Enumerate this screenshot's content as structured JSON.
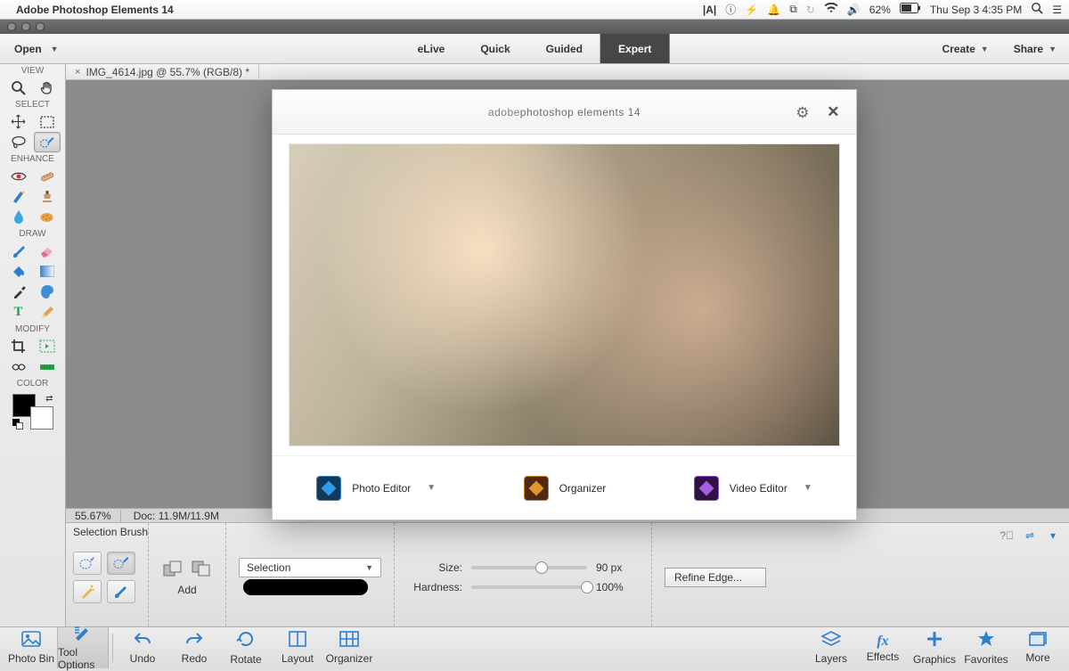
{
  "mac_menubar": {
    "app_name": "Adobe Photoshop Elements 14",
    "battery": "62%",
    "clock": "Thu Sep 3  4:35 PM"
  },
  "top_toolbar": {
    "open_label": "Open",
    "modes": {
      "elive": "eLive",
      "quick": "Quick",
      "guided": "Guided",
      "expert": "Expert"
    },
    "create_label": "Create",
    "share_label": "Share"
  },
  "sidebar": {
    "labels": {
      "view": "VIEW",
      "select": "SELECT",
      "enhance": "ENHANCE",
      "draw": "DRAW",
      "modify": "MODIFY",
      "color": "COLOR"
    }
  },
  "doc_tab": {
    "title": "IMG_4614.jpg @ 55.7% (RGB/8) *"
  },
  "status": {
    "zoom": "55.67%",
    "doc": "Doc: 11.9M/11.9M"
  },
  "options": {
    "tool_name": "Selection Brush",
    "mode_add": "Add",
    "combo_value": "Selection",
    "size_lbl": "Size:",
    "size_val": "90 px",
    "hardness_lbl": "Hardness:",
    "hardness_val": "100%",
    "refine": "Refine Edge..."
  },
  "bottom_bar": {
    "photo_bin": "Photo Bin",
    "tool_options": "Tool Options",
    "undo": "Undo",
    "redo": "Redo",
    "rotate": "Rotate",
    "layout": "Layout",
    "organizer": "Organizer",
    "layers": "Layers",
    "effects": "Effects",
    "graphics": "Graphics",
    "favorites": "Favorites",
    "more": "More"
  },
  "welcome": {
    "brand_light": "adobe ",
    "brand_strong": "photoshop elements 14",
    "photo_editor": "Photo Editor",
    "organizer": "Organizer",
    "video_editor": "Video Editor"
  }
}
